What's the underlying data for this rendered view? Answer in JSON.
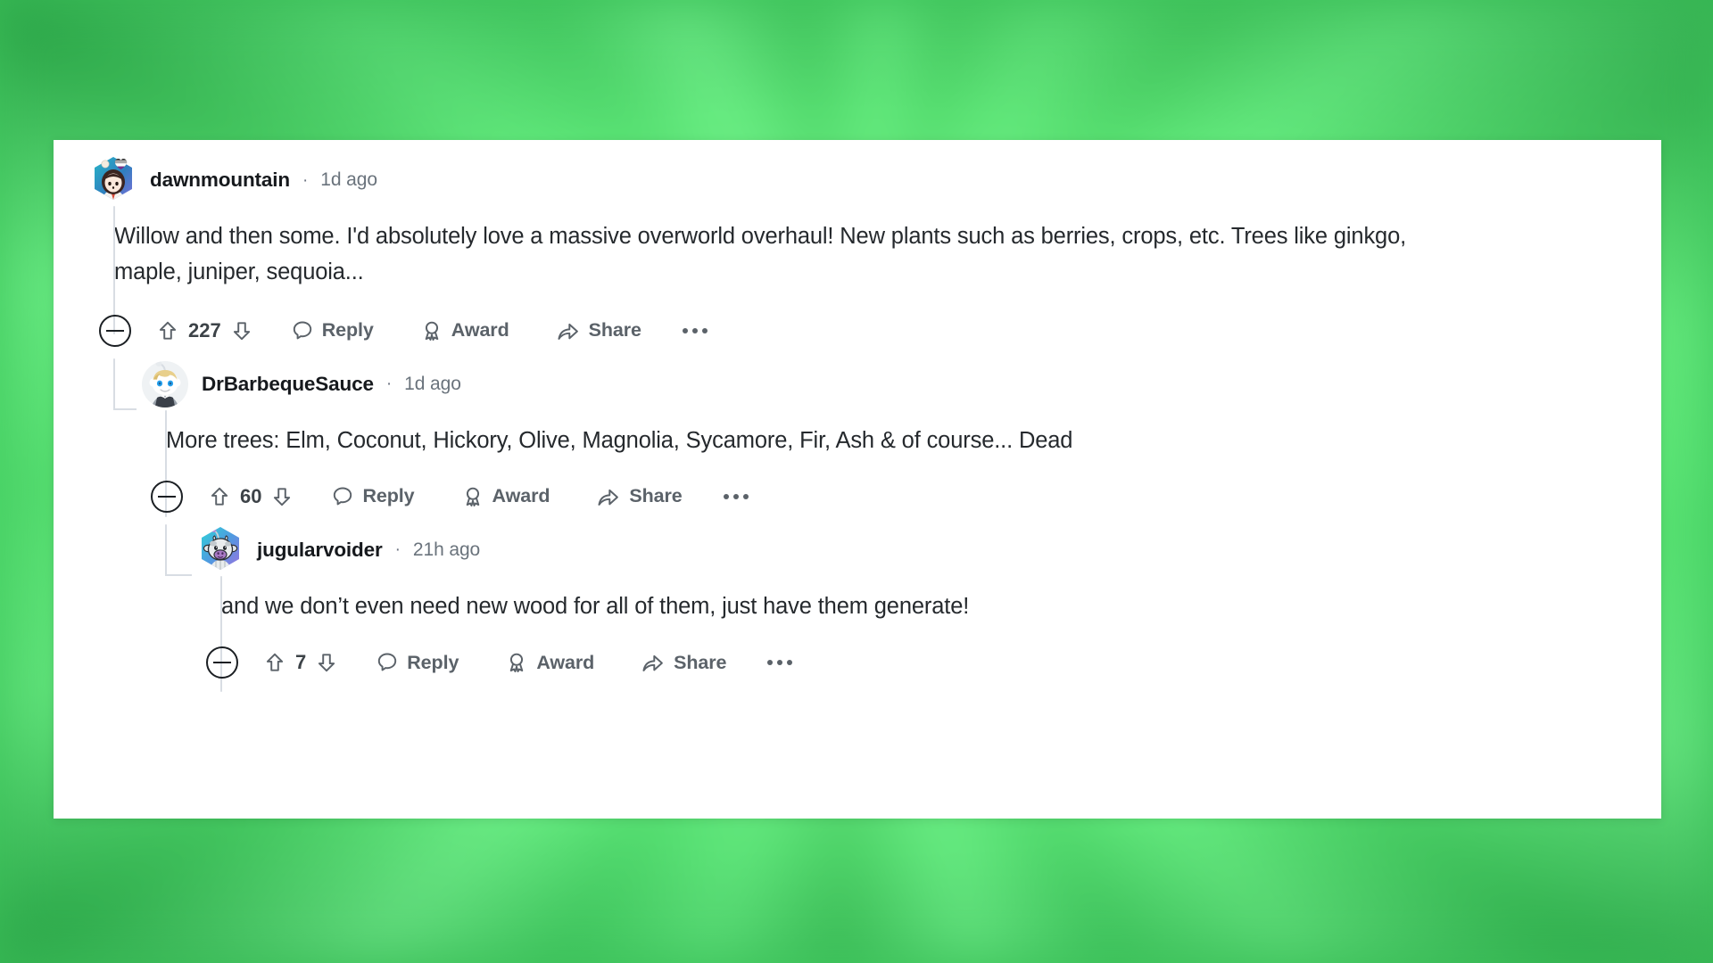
{
  "background": {
    "style": "green-starburst-gradient",
    "base_color": "#46d264",
    "highlight_color": "#7df59a",
    "shadow_color": "#2e9e4c"
  },
  "card": {
    "background_color": "#ffffff"
  },
  "action_labels": {
    "reply": "Reply",
    "award": "Award",
    "share": "Share",
    "collapse": "collapse-thread",
    "overflow": "more-options"
  },
  "icons": {
    "collapse": "minus-circle-icon",
    "upvote": "upvote-arrow-icon",
    "downvote": "downvote-arrow-icon",
    "reply": "comment-bubble-icon",
    "award": "award-ribbon-icon",
    "share": "share-arrow-icon",
    "overflow": "ellipsis-icon"
  },
  "comments": [
    {
      "id": "comment-1",
      "depth": 0,
      "username": "dawnmountain",
      "separator": "·",
      "timestamp": "1d ago",
      "body": "Willow and then some. I'd absolutely love a massive overworld overhaul! New plants such as berries, crops, etc. Trees like ginkgo, maple, juniper, sequoia...",
      "score": "227",
      "avatar": "hexagon-girl-avatar"
    },
    {
      "id": "comment-2",
      "depth": 1,
      "username": "DrBarbequeSauce",
      "separator": "·",
      "timestamp": "1d ago",
      "body": "More trees: Elm, Coconut, Hickory, Olive, Magnolia, Sycamore, Fir, Ash & of course... Dead",
      "score": "60",
      "avatar": "circle-snoo-suit-avatar"
    },
    {
      "id": "comment-3",
      "depth": 2,
      "username": "jugularvoider",
      "separator": "·",
      "timestamp": "21h ago",
      "body": "and we don’t even need new wood for all of them, just have them generate!",
      "score": "7",
      "avatar": "hexagon-cow-avatar"
    }
  ]
}
